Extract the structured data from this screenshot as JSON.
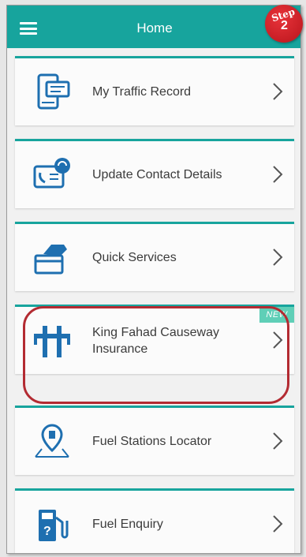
{
  "header": {
    "title": "Home",
    "step_label": "Step",
    "step_number": "2"
  },
  "menu": [
    {
      "label": "My Traffic Record",
      "icon": "phone-record-icon"
    },
    {
      "label": "Update Contact Details",
      "icon": "contact-card-icon"
    },
    {
      "label": "Quick Services",
      "icon": "card-hand-icon"
    },
    {
      "label": "King Fahad Causeway Insurance",
      "icon": "causeway-icon",
      "badge": "NEW"
    },
    {
      "label": "Fuel Stations Locator",
      "icon": "location-pin-icon"
    },
    {
      "label": "Fuel Enquiry",
      "icon": "fuel-pump-icon"
    }
  ],
  "colors": {
    "accent": "#17a49d",
    "icon_blue": "#1e6fb0",
    "highlight": "#b32b32",
    "badge": "#5fcfb7"
  }
}
